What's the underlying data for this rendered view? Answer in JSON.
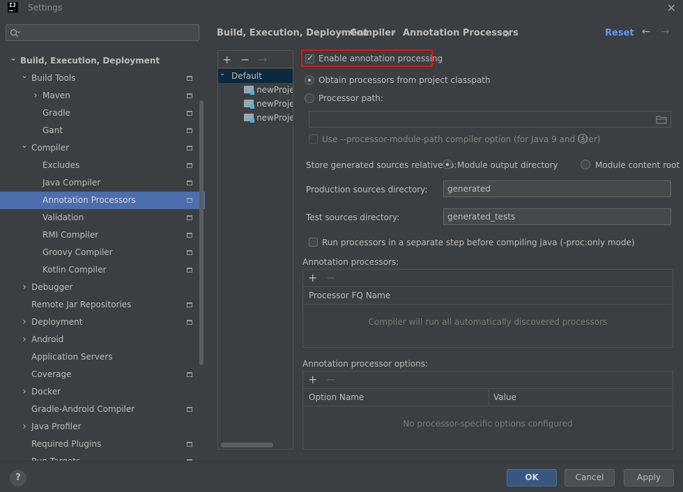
{
  "window": {
    "title": "Settings",
    "logo_text": "IJ",
    "close_glyph": "✕"
  },
  "sidebar": {
    "search_placeholder": "",
    "items": [
      {
        "label": "Build, Execution, Deployment",
        "level": 0,
        "expanded": true,
        "bold": true
      },
      {
        "label": "Build Tools",
        "level": 1,
        "expanded": true,
        "project_icon": true
      },
      {
        "label": "Maven",
        "level": 2,
        "expanded": false,
        "project_icon": true
      },
      {
        "label": "Gradle",
        "level": 2,
        "project_icon": true
      },
      {
        "label": "Gant",
        "level": 2,
        "project_icon": true
      },
      {
        "label": "Compiler",
        "level": 1,
        "expanded": true,
        "project_icon": true
      },
      {
        "label": "Excludes",
        "level": 2,
        "project_icon": true
      },
      {
        "label": "Java Compiler",
        "level": 2,
        "project_icon": true
      },
      {
        "label": "Annotation Processors",
        "level": 2,
        "project_icon": true,
        "selected": true
      },
      {
        "label": "Validation",
        "level": 2,
        "project_icon": true
      },
      {
        "label": "RMI Compiler",
        "level": 2,
        "project_icon": true
      },
      {
        "label": "Groovy Compiler",
        "level": 2,
        "project_icon": true
      },
      {
        "label": "Kotlin Compiler",
        "level": 2,
        "project_icon": true
      },
      {
        "label": "Debugger",
        "level": 1,
        "expanded": false
      },
      {
        "label": "Remote Jar Repositories",
        "level": 1,
        "project_icon": true
      },
      {
        "label": "Deployment",
        "level": 1,
        "expanded": false,
        "project_icon": true
      },
      {
        "label": "Android",
        "level": 1,
        "expanded": false
      },
      {
        "label": "Application Servers",
        "level": 1
      },
      {
        "label": "Coverage",
        "level": 1,
        "project_icon": true
      },
      {
        "label": "Docker",
        "level": 1,
        "expanded": false
      },
      {
        "label": "Gradle-Android Compiler",
        "level": 1,
        "project_icon": true
      },
      {
        "label": "Java Profiler",
        "level": 1,
        "expanded": false
      },
      {
        "label": "Required Plugins",
        "level": 1,
        "project_icon": true
      },
      {
        "label": "Run Targets",
        "level": 1,
        "project_icon": true
      }
    ]
  },
  "header": {
    "crumbs": [
      "Build, Execution, Deployment",
      "Compiler",
      "Annotation Processors"
    ],
    "separator": "›",
    "reset_label": "Reset",
    "back_glyph": "←",
    "forward_glyph": "→"
  },
  "profiles": {
    "add_glyph": "+",
    "remove_glyph": "−",
    "move_glyph": "→",
    "chevron_glyph": "⌄",
    "items": [
      {
        "label": "Default",
        "type": "group"
      },
      {
        "label": "newProject",
        "type": "module"
      },
      {
        "label": "newProject",
        "type": "module"
      },
      {
        "label": "newProject",
        "type": "module"
      }
    ]
  },
  "settings": {
    "enable_label": "Enable annotation processing",
    "enable_checked": true,
    "obtain_label": "Obtain processors from project classpath",
    "processor_path_label": "Processor path:",
    "processor_path_value": "",
    "module_path_label": "Use --processor-module-path compiler option (for Java 9 and later)",
    "help_glyph": "?",
    "store_label": "Store generated sources relative to:",
    "module_output_label": "Module output directory",
    "module_content_label": "Module content root",
    "production_label": "Production sources directory:",
    "production_value": "generated",
    "test_label": "Test sources directory:",
    "test_value": "generated_tests",
    "separate_step_label": "Run processors in a separate step before compiling java (-proc:only mode)",
    "annotation_processors_label": "Annotation processors:",
    "processor_fq_header": "Processor FQ Name",
    "processors_empty": "Compiler will run all automatically discovered processors",
    "options_label": "Annotation processor options:",
    "option_name_header": "Option Name",
    "value_header": "Value",
    "options_empty": "No processor-specific options configured",
    "add_glyph": "+",
    "remove_glyph": "−"
  },
  "footer": {
    "help_glyph": "?",
    "ok_label": "OK",
    "cancel_label": "Cancel",
    "apply_label": "Apply"
  },
  "colors": {
    "background": "#3c3f41",
    "selection": "#4b6eaf",
    "highlight_border": "#e31212",
    "link": "#589df6",
    "primary_button": "#365880"
  }
}
